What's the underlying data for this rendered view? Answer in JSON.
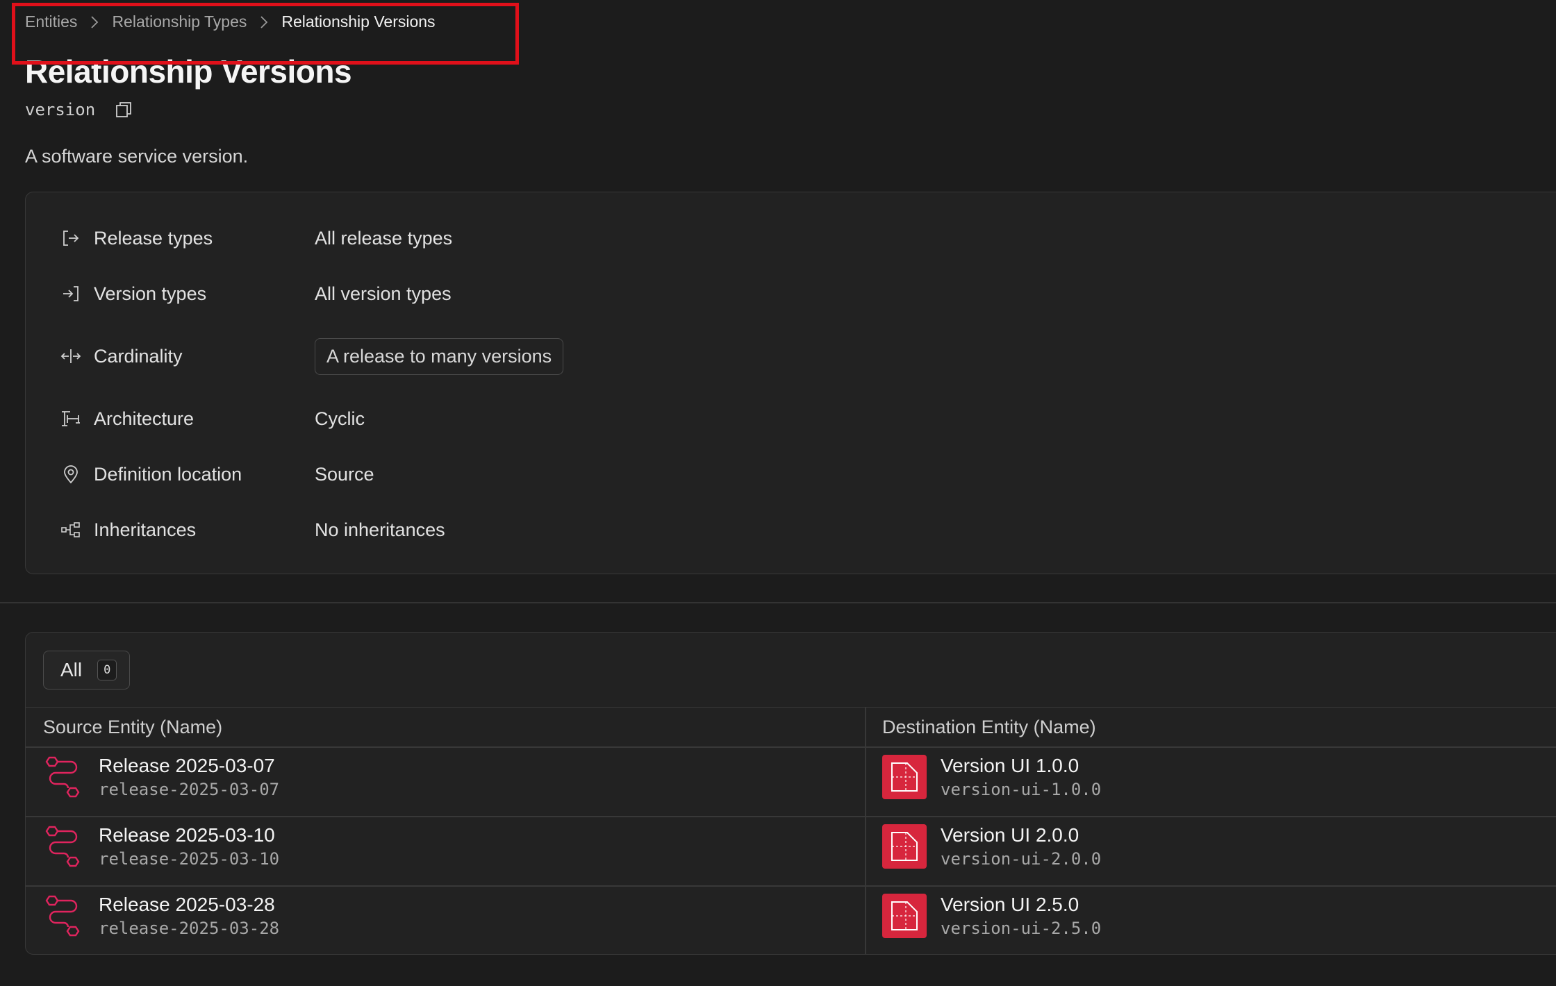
{
  "breadcrumb": {
    "items": [
      "Entities",
      "Relationship Types",
      "Relationship Versions"
    ]
  },
  "header": {
    "title": "Relationship Versions",
    "slug": "version",
    "description": "A software service version."
  },
  "properties": [
    {
      "label": "Release types",
      "value": "All release types",
      "icon": "arrow-out-icon"
    },
    {
      "label": "Version types",
      "value": "All version types",
      "icon": "arrow-in-icon"
    },
    {
      "label": "Cardinality",
      "value": "A release to many versions",
      "icon": "cardinality-icon"
    },
    {
      "label": "Architecture",
      "value": "Cyclic",
      "icon": "architecture-icon"
    },
    {
      "label": "Definition location",
      "value": "Source",
      "icon": "location-pin-icon"
    },
    {
      "label": "Inheritances",
      "value": "No inheritances",
      "icon": "hierarchy-icon"
    }
  ],
  "table": {
    "filter_label": "All",
    "filter_count": "0",
    "columns": [
      "Source Entity (Name)",
      "Destination Entity (Name)"
    ],
    "rows": [
      {
        "source_name": "Release 2025-03-07",
        "source_slug": "release-2025-03-07",
        "dest_name": "Version UI 1.0.0",
        "dest_slug": "version-ui-1.0.0"
      },
      {
        "source_name": "Release 2025-03-10",
        "source_slug": "release-2025-03-10",
        "dest_name": "Version UI 2.0.0",
        "dest_slug": "version-ui-2.0.0"
      },
      {
        "source_name": "Release 2025-03-28",
        "source_slug": "release-2025-03-28",
        "dest_name": "Version UI 2.5.0",
        "dest_slug": "version-ui-2.5.0"
      }
    ]
  },
  "colors": {
    "background": "#1c1c1c",
    "card": "#222222",
    "highlight": "#e0101a",
    "release_icon": "#e0245e",
    "version_icon": "#d7263d"
  }
}
